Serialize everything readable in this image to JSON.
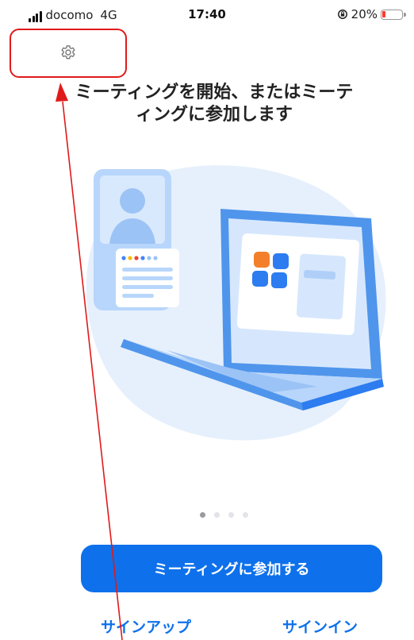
{
  "status_bar": {
    "carrier": "docomo",
    "network": "4G",
    "time": "17:40",
    "battery_percent": "20%"
  },
  "settings": {
    "icon": "gear-icon"
  },
  "headline": {
    "line1": "ミーティングを開始、またはミーテ",
    "line2": "ィングに参加します"
  },
  "pager": {
    "total": 4,
    "active": 1
  },
  "buttons": {
    "join": "ミーティングに参加する",
    "signup": "サインアップ",
    "signin": "サインイン"
  },
  "colors": {
    "accent": "#0e71eb",
    "annotation": "#e01a1a",
    "battery_low": "#ff3b30"
  }
}
